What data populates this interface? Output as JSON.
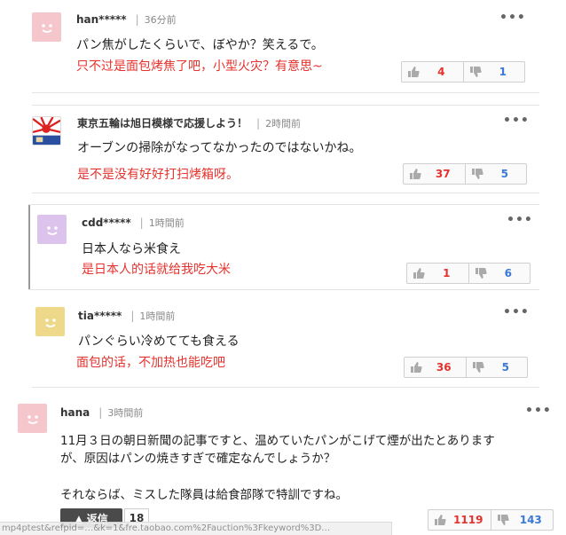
{
  "comments": [
    {
      "user": "han*****",
      "time": "36分前",
      "text": "パン焦がしたくらいで、ぼやか？笑えるで。",
      "translation": "只不过是面包烤焦了吧，小型火灾？有意思~",
      "good": "4",
      "bad": "1",
      "more": "•••"
    },
    {
      "user": "東京五輪は旭日模様で応援しよう！",
      "time": "2時間前",
      "text": "オーブンの掃除がなってなかったのではないかね。",
      "translation": "是不是没有好好打扫烤箱呀。",
      "good": "37",
      "bad": "5",
      "more": "•••"
    },
    {
      "user": "cdd*****",
      "time": "1時間前",
      "text": "日本人なら米食え",
      "translation": "是日本人的话就给我吃大米",
      "good": "1",
      "bad": "6",
      "more": "•••"
    },
    {
      "user": "tia*****",
      "time": "1時間前",
      "text": "パンぐらい冷めてても食える",
      "translation": "面包的话，不加热也能吃吧",
      "good": "36",
      "bad": "5",
      "more": "•••"
    },
    {
      "user": "hana",
      "time": "3時間前",
      "text_line1": "11月３日の朝日新聞の記事ですと、温めていたパンがこげて煙が出たとあります",
      "text_line2": "が、原因はパンの焼きすぎで確定なんでしょうか？",
      "text_line3": "それならば、ミスした隊員は給食部隊で特訓ですね。",
      "good": "1119",
      "bad": "143",
      "more": "•••"
    }
  ],
  "reply_button": {
    "label": "▲ 返信",
    "count": "18"
  },
  "status_url": "mp4ptest&refpid=…&k=1&fre.taobao.com%2Fauction%3Fkeyword%3D…",
  "colors": {
    "translation": "#e5322d",
    "good": "#e5322d",
    "bad": "#3b7ad4"
  }
}
